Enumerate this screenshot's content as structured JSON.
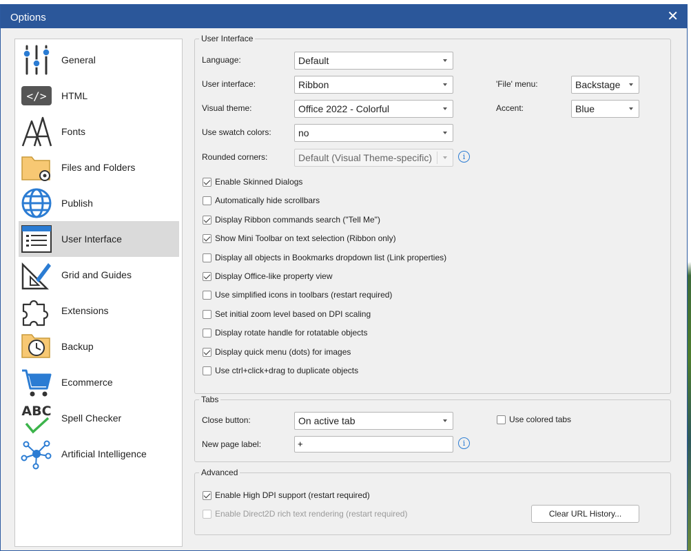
{
  "window": {
    "title": "Options",
    "close_glyph": "✕"
  },
  "nav": [
    {
      "label": "General",
      "icon": "sliders-icon"
    },
    {
      "label": "HTML",
      "icon": "code-icon"
    },
    {
      "label": "Fonts",
      "icon": "font-icon"
    },
    {
      "label": "Files and Folders",
      "icon": "folder-gear-icon"
    },
    {
      "label": "Publish",
      "icon": "globe-icon"
    },
    {
      "label": "User Interface",
      "icon": "window-list-icon",
      "selected": true
    },
    {
      "label": "Grid and Guides",
      "icon": "ruler-pencil-icon"
    },
    {
      "label": "Extensions",
      "icon": "puzzle-icon"
    },
    {
      "label": "Backup",
      "icon": "folder-clock-icon"
    },
    {
      "label": "Ecommerce",
      "icon": "cart-icon"
    },
    {
      "label": "Spell Checker",
      "icon": "abc-check-icon",
      "icon_text": "ABC"
    },
    {
      "label": "Artificial Intelligence",
      "icon": "network-icon"
    }
  ],
  "ui": {
    "legend": "User Interface",
    "language_label": "Language:",
    "language_value": "Default",
    "ui_label": "User interface:",
    "ui_value": "Ribbon",
    "file_menu_label": "'File' menu:",
    "file_menu_value": "Backstage",
    "theme_label": "Visual theme:",
    "theme_value": "Office 2022 - Colorful",
    "accent_label": "Accent:",
    "accent_value": "Blue",
    "swatch_label": "Use swatch colors:",
    "swatch_value": "no",
    "rounded_label": "Rounded corners:",
    "rounded_value": "Default (Visual Theme-specific)",
    "info_glyph": "i",
    "checks": [
      {
        "label": "Enable Skinned Dialogs",
        "checked": true
      },
      {
        "label": "Automatically hide scrollbars",
        "checked": false
      },
      {
        "label": "Display Ribbon commands search (\"Tell Me\")",
        "checked": true
      },
      {
        "label": "Show Mini Toolbar on text selection (Ribbon only)",
        "checked": true
      },
      {
        "label": "Display all objects in Bookmarks dropdown list (Link properties)",
        "checked": false
      },
      {
        "label": "Display Office-like property view",
        "checked": true
      },
      {
        "label": "Use simplified icons in toolbars (restart required)",
        "checked": false
      },
      {
        "label": "Set initial zoom level based on DPI scaling",
        "checked": false
      },
      {
        "label": "Display rotate handle for rotatable objects",
        "checked": false
      },
      {
        "label": "Display quick menu (dots) for images",
        "checked": true
      },
      {
        "label": "Use ctrl+click+drag to duplicate objects",
        "checked": false
      }
    ]
  },
  "tabs": {
    "legend": "Tabs",
    "close_label": "Close button:",
    "close_value": "On active tab",
    "colored_label": "Use colored tabs",
    "colored_checked": false,
    "newpage_label": "New page label:",
    "newpage_value": "+"
  },
  "advanced": {
    "legend": "Advanced",
    "hidpi_label": "Enable High DPI support (restart required)",
    "hidpi_checked": true,
    "d2d_label": "Enable Direct2D rich text rendering (restart required)",
    "d2d_checked": false,
    "clear_url_label": "Clear URL History..."
  }
}
